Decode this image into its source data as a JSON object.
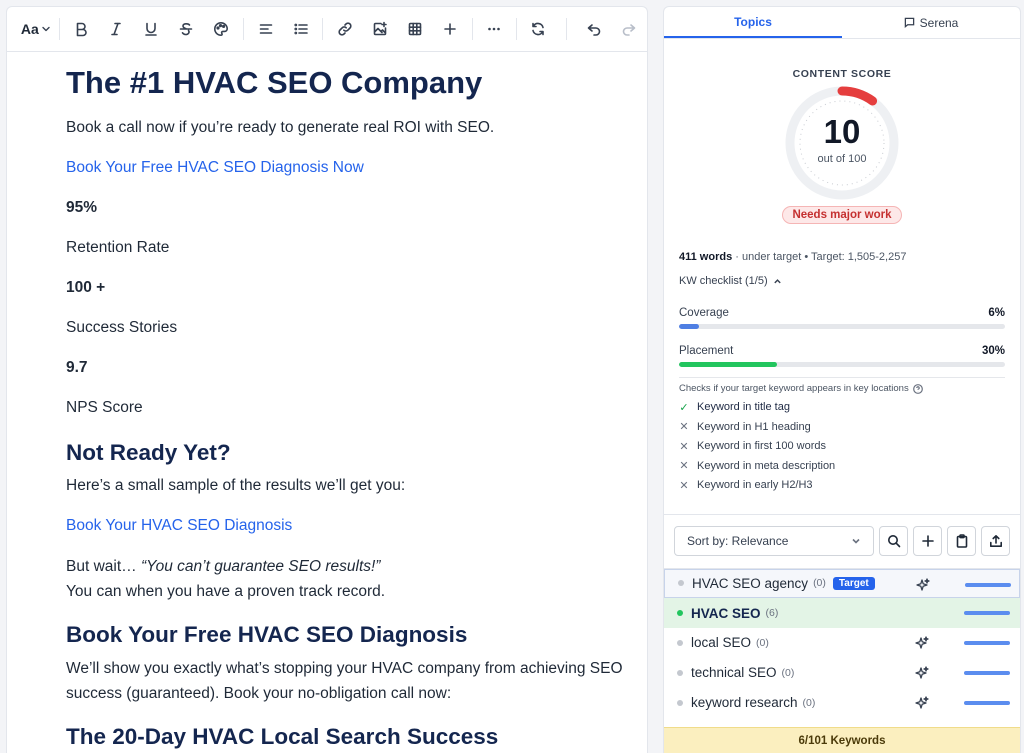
{
  "toolbar": {
    "font_label": "Aa",
    "items": [
      {
        "name": "bold-icon"
      },
      {
        "name": "italic-icon"
      },
      {
        "name": "underline-icon"
      },
      {
        "name": "strikethrough-icon"
      },
      {
        "name": "palette-icon"
      },
      {
        "name": "align-left-icon"
      },
      {
        "name": "bullet-list-icon"
      },
      {
        "name": "link-icon"
      },
      {
        "name": "insert-image-icon"
      },
      {
        "name": "table-icon"
      },
      {
        "name": "plus-icon"
      },
      {
        "name": "more-icon"
      },
      {
        "name": "refresh-icon"
      },
      {
        "name": "undo-icon"
      },
      {
        "name": "redo-icon"
      }
    ]
  },
  "editor": {
    "h1": "The #1 HVAC SEO Company",
    "p1": "Book a call now if you’re ready to generate real ROI with SEO.",
    "link1": "Book Your Free HVAC SEO Diagnosis Now",
    "stat1_value": "95%",
    "stat1_label": "Retention Rate",
    "stat2_value": "100 +",
    "stat2_label": "Success Stories",
    "stat3_value": "9.7",
    "stat3_label": "NPS Score",
    "h2_1": "Not Ready Yet?",
    "p2": "Here’s a small sample of the results we’ll get you:",
    "link2": "Book Your HVAC SEO Diagnosis",
    "p3_prefix": "But wait… ",
    "p3_quote": "“You can’t guarantee SEO results!”",
    "p3_line2": "You can when you have a proven track record.",
    "h2_2": "Book Your Free HVAC SEO Diagnosis",
    "p4": "We’ll show you exactly what’s stopping your HVAC company from achieving SEO success (guaranteed). Book your no-obligation call now:",
    "h2_3_partial": "The 20-Day HVAC Local Search Success"
  },
  "side": {
    "tabs": [
      "Topics",
      "Serena"
    ],
    "score_label": "CONTENT SCORE",
    "score": "10",
    "score_sub": "out of 100",
    "score_value": 10,
    "score_badge": "Needs major work",
    "words_count": "411 words",
    "words_rest": " · under target • Target: 1,505-2,257",
    "kw_checklist": "KW checklist (1/5)",
    "coverage_label": "Coverage",
    "coverage_value": "6%",
    "coverage_pct": 6,
    "placement_label": "Placement",
    "placement_value": "30%",
    "placement_pct": 30,
    "checks_note": "Checks if your target keyword appears in key locations",
    "checks": [
      {
        "label": "Keyword in title tag",
        "ok": true
      },
      {
        "label": "Keyword in H1 heading",
        "ok": false
      },
      {
        "label": "Keyword in first 100 words",
        "ok": false
      },
      {
        "label": "Keyword in meta description",
        "ok": false
      },
      {
        "label": "Keyword in early H2/H3",
        "ok": false
      }
    ],
    "sort_label": "Sort by: Relevance",
    "keywords": [
      {
        "name": "HVAC SEO agency",
        "count": "(0)",
        "badge": "Target"
      },
      {
        "name": "HVAC SEO",
        "count": "(6)"
      },
      {
        "name": "local SEO",
        "count": "(0)"
      },
      {
        "name": "technical SEO",
        "count": "(0)"
      },
      {
        "name": "keyword research",
        "count": "(0)"
      }
    ],
    "footer": "6/101 Keywords"
  },
  "colors": {
    "heading": "#14264f",
    "link": "#2563eb",
    "accent": "#2563eb",
    "danger": "#e53e3e",
    "success": "#22c55e",
    "footer_bg": "#fbefbf"
  }
}
